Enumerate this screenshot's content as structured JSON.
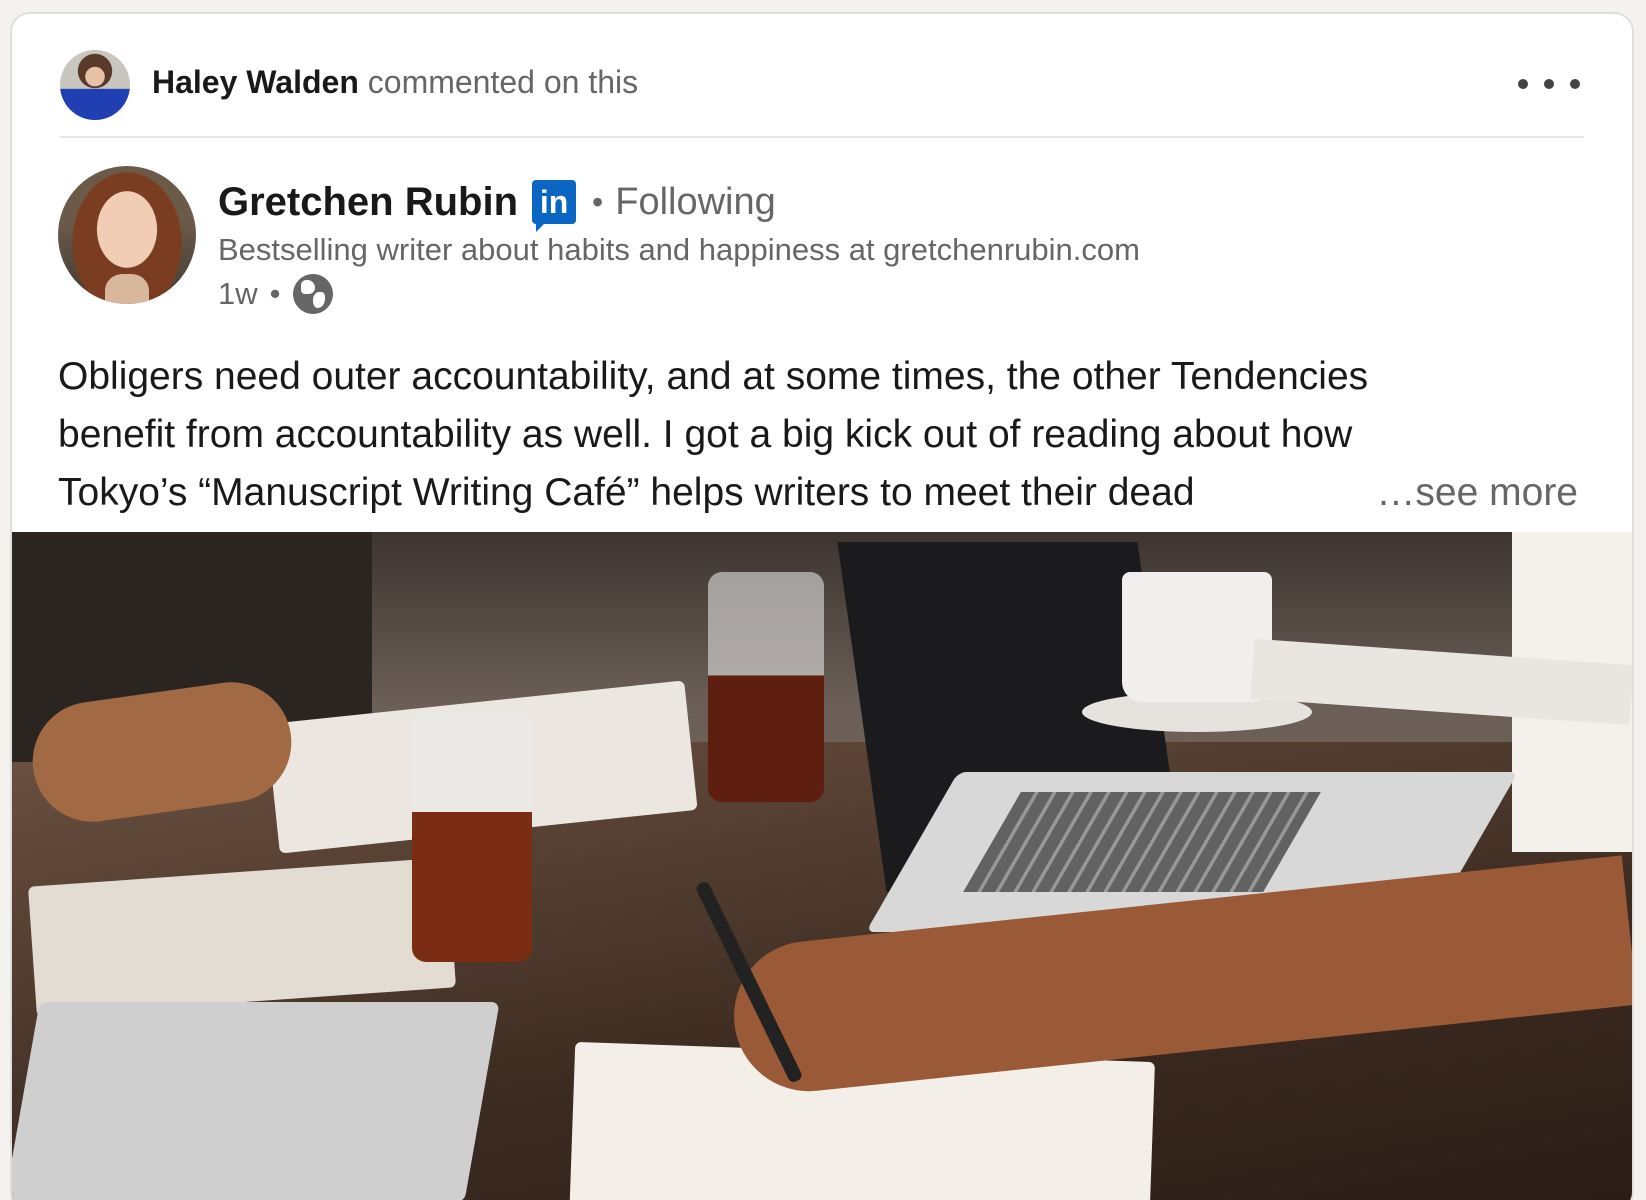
{
  "activity": {
    "actor_name": "Haley Walden",
    "action_text": "commented on this",
    "more_icon": "ellipsis-icon"
  },
  "post": {
    "author_name": "Gretchen Rubin",
    "badge_icon": "linkedin-icon",
    "badge_text": "in",
    "separator": "•",
    "follow_status": "Following",
    "headline": "Bestselling writer about habits and happiness at gretchenrubin.com",
    "time": "1w",
    "visibility_icon": "globe-icon",
    "text_lines": [
      "Obligers need outer accountability, and at some times, the other Tendencies",
      "benefit from accountability as well. I got a big kick out of reading about how",
      "Tokyo’s “Manuscript Writing Café” helps writers to meet their dead"
    ],
    "see_more": "…see more"
  },
  "colors": {
    "linkedin_blue": "#0a66c2",
    "muted_text": "#666666",
    "primary_text": "#191919"
  }
}
